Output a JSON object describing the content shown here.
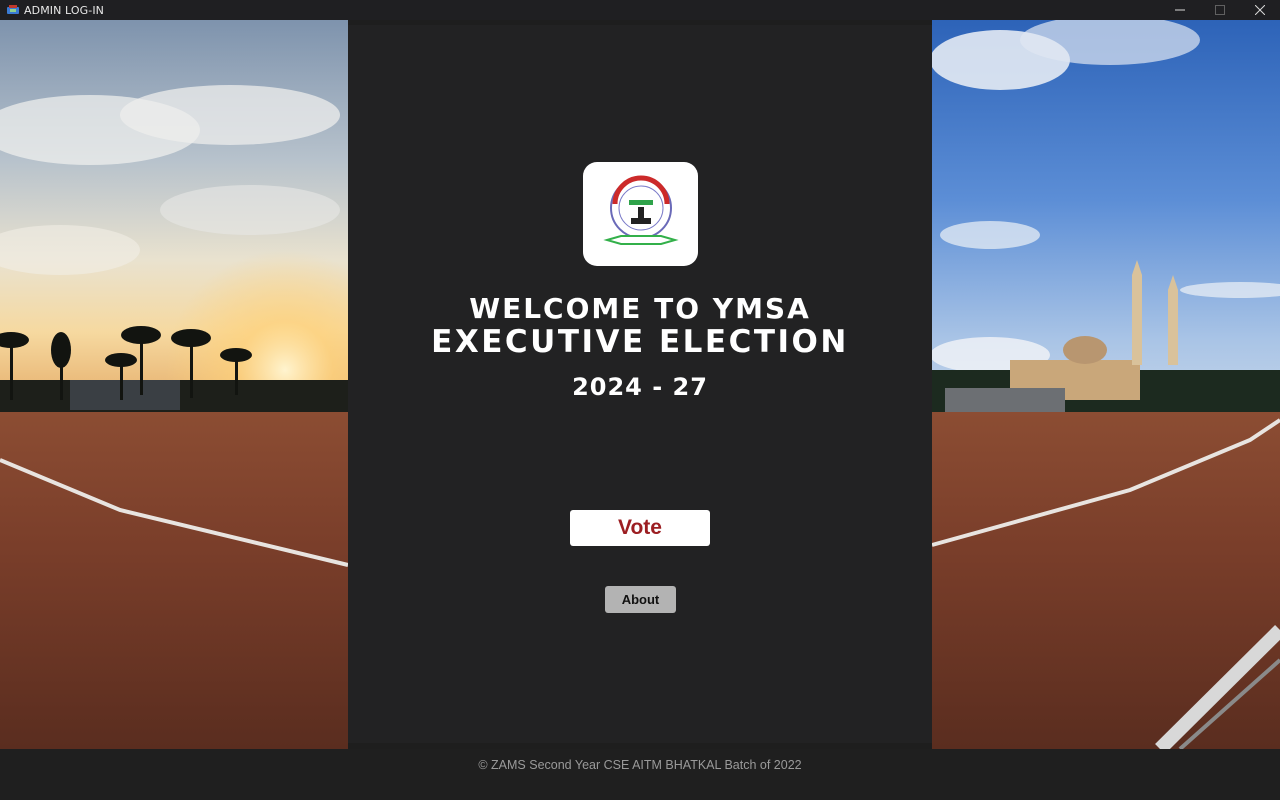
{
  "window": {
    "title": "ADMIN LOG-IN",
    "icon": "app-icon"
  },
  "panel": {
    "logo_icon": "ymsa-logo",
    "logo_text": "Y.M.S.A",
    "welcome_line1": "WELCOME TO YMSA",
    "welcome_line2": "EXECUTIVE ELECTION",
    "years": "2024 - 27",
    "vote_label": "Vote",
    "about_label": "About"
  },
  "footer": {
    "text": "© ZAMS Second Year CSE AITM BHATKAL Batch of 2022"
  },
  "colors": {
    "panel_bg": "#222223",
    "vote_text": "#9c1e22",
    "about_bg": "#b3b3b3"
  }
}
